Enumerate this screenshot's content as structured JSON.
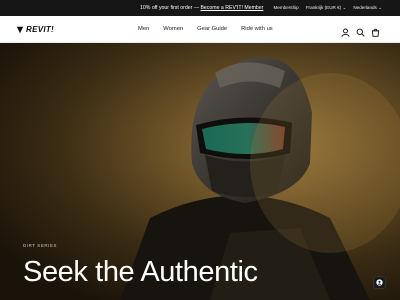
{
  "promo": {
    "text": "10% off your first order — ",
    "link": "Become a REV'IT! Member"
  },
  "utility": {
    "membership": "Membership",
    "currency": "Frankrijk (EUR €)",
    "language": "Nederlands"
  },
  "header": {
    "logo_text": "REVIT!",
    "nav": [
      "Men",
      "Women",
      "Gear Guide",
      "Ride with us"
    ],
    "icons": [
      "account-icon",
      "search-icon",
      "cart-icon"
    ]
  },
  "hero": {
    "eyebrow": "DIRT SERIES",
    "headline": "Seek the Authentic"
  },
  "chat": {
    "icon": "chat-icon"
  }
}
